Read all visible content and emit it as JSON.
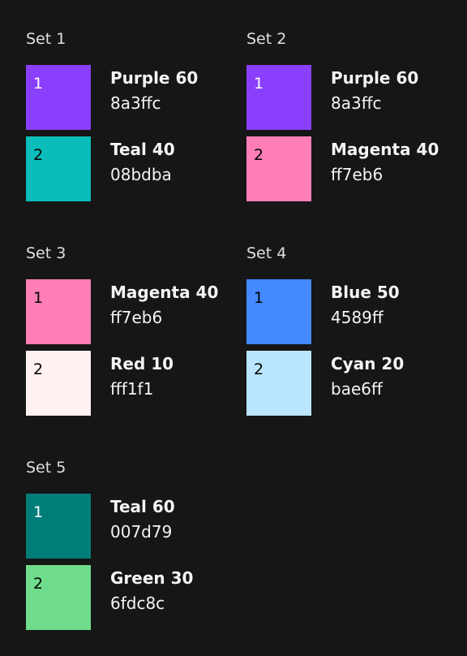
{
  "sets": [
    {
      "title": "Set 1",
      "swatches": [
        {
          "number": "1",
          "name": "Purple 60",
          "hex": "8a3ffc",
          "color": "#8a3ffc",
          "text_color": "#ffffff"
        },
        {
          "number": "2",
          "name": "Teal 40",
          "hex": "08bdba",
          "color": "#08bdba",
          "text_color": "#000000"
        }
      ]
    },
    {
      "title": "Set 2",
      "swatches": [
        {
          "number": "1",
          "name": "Purple 60",
          "hex": "8a3ffc",
          "color": "#8a3ffc",
          "text_color": "#ffffff"
        },
        {
          "number": "2",
          "name": "Magenta 40",
          "hex": "ff7eb6",
          "color": "#ff7eb6",
          "text_color": "#000000"
        }
      ]
    },
    {
      "title": "Set 3",
      "swatches": [
        {
          "number": "1",
          "name": "Magenta 40",
          "hex": "ff7eb6",
          "color": "#ff7eb6",
          "text_color": "#000000"
        },
        {
          "number": "2",
          "name": "Red 10",
          "hex": "fff1f1",
          "color": "#fff1f1",
          "text_color": "#000000"
        }
      ]
    },
    {
      "title": "Set 4",
      "swatches": [
        {
          "number": "1",
          "name": "Blue 50",
          "hex": "4589ff",
          "color": "#4589ff",
          "text_color": "#000000"
        },
        {
          "number": "2",
          "name": "Cyan 20",
          "hex": "bae6ff",
          "color": "#bae6ff",
          "text_color": "#000000"
        }
      ]
    },
    {
      "title": "Set 5",
      "swatches": [
        {
          "number": "1",
          "name": "Teal 60",
          "hex": "007d79",
          "color": "#007d79",
          "text_color": "#ffffff"
        },
        {
          "number": "2",
          "name": "Green 30",
          "hex": "6fdc8c",
          "color": "#6fdc8c",
          "text_color": "#000000"
        }
      ]
    }
  ]
}
